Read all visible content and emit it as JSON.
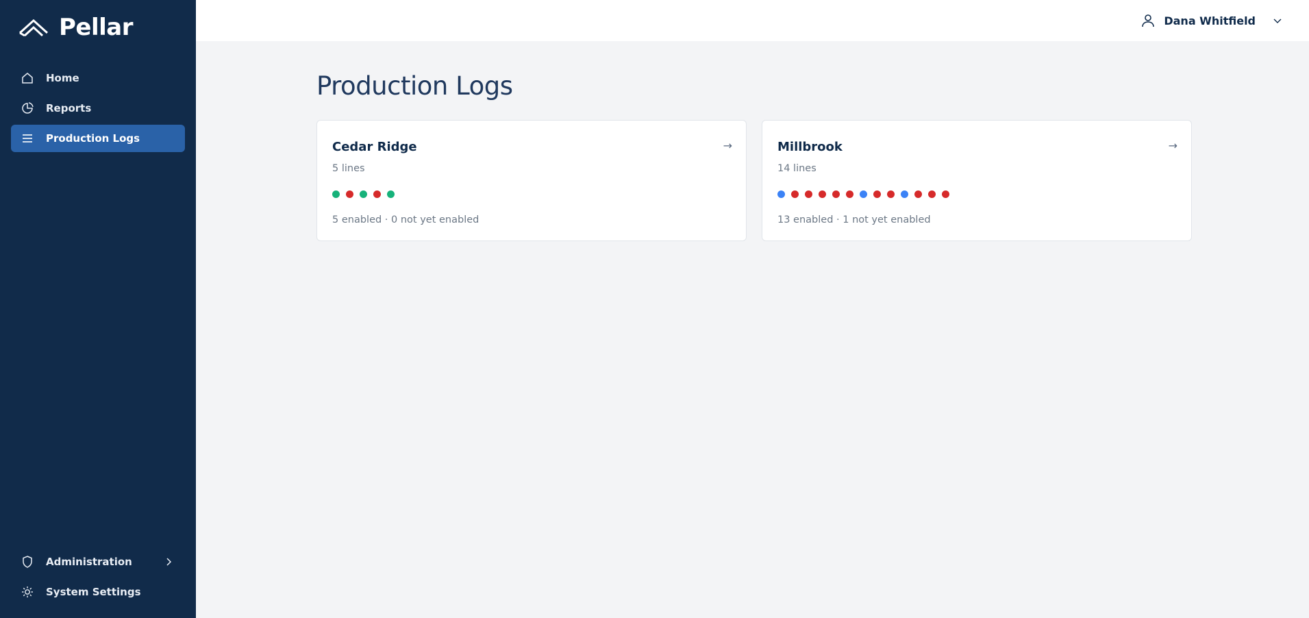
{
  "app": {
    "name": "Pellar"
  },
  "sidebar": {
    "items": [
      {
        "label": "Home",
        "icon": "home-icon"
      },
      {
        "label": "Reports",
        "icon": "pie-chart-icon"
      },
      {
        "label": "Production Logs",
        "icon": "list-icon",
        "active": true
      }
    ],
    "bottom_items": [
      {
        "label": "Administration",
        "icon": "shield-icon"
      },
      {
        "label": "System Settings",
        "icon": "sun-icon"
      }
    ]
  },
  "header": {
    "user_name": "Dana Whitfield"
  },
  "main": {
    "title": "Production Logs",
    "cards": [
      {
        "name": "Cedar Ridge",
        "lines_label": "5 lines",
        "status_summary": "5 enabled · 0 not yet enabled",
        "dots": [
          "green",
          "red",
          "green",
          "red",
          "green"
        ]
      },
      {
        "name": "Millbrook",
        "lines_label": "14 lines",
        "status_summary": "13 enabled · 1 not yet enabled",
        "dots": [
          "blue",
          "red",
          "red",
          "red",
          "red",
          "red",
          "blue",
          "red",
          "red",
          "blue",
          "red",
          "red",
          "red"
        ]
      }
    ]
  },
  "colors": {
    "sidebar_bg": "#112b4a",
    "active_nav": "#2a62a8",
    "green": "#16b27a",
    "red": "#d62a2a",
    "blue": "#3b82f6"
  }
}
